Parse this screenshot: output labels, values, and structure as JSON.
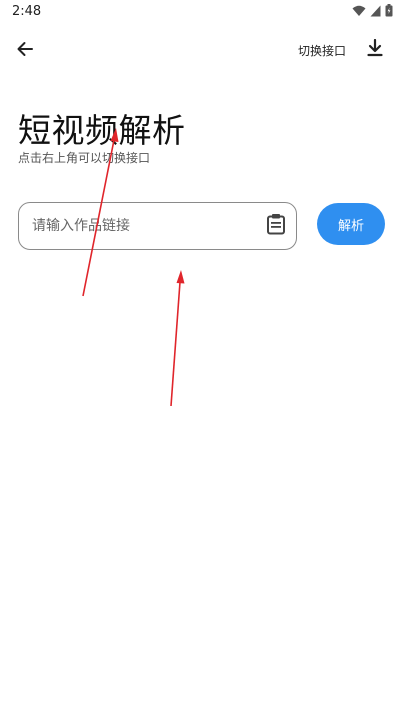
{
  "status_bar": {
    "time": "2:48",
    "icons": [
      "wifi-icon",
      "signal-icon",
      "battery-icon"
    ]
  },
  "app_bar": {
    "back_icon": "arrow-left-icon",
    "switch_api_label": "切换接口",
    "download_icon": "download-icon"
  },
  "main": {
    "title": "短视频解析",
    "subtitle": "点击右上角可以切换接口",
    "link_input": {
      "value": "",
      "placeholder": "请输入作品链接"
    },
    "paste_icon": "clipboard-icon",
    "parse_button_label": "解析"
  },
  "colors": {
    "accent": "#2f8ff0",
    "annotation_arrow": "#e0252b",
    "input_border": "#8a8a8a"
  }
}
